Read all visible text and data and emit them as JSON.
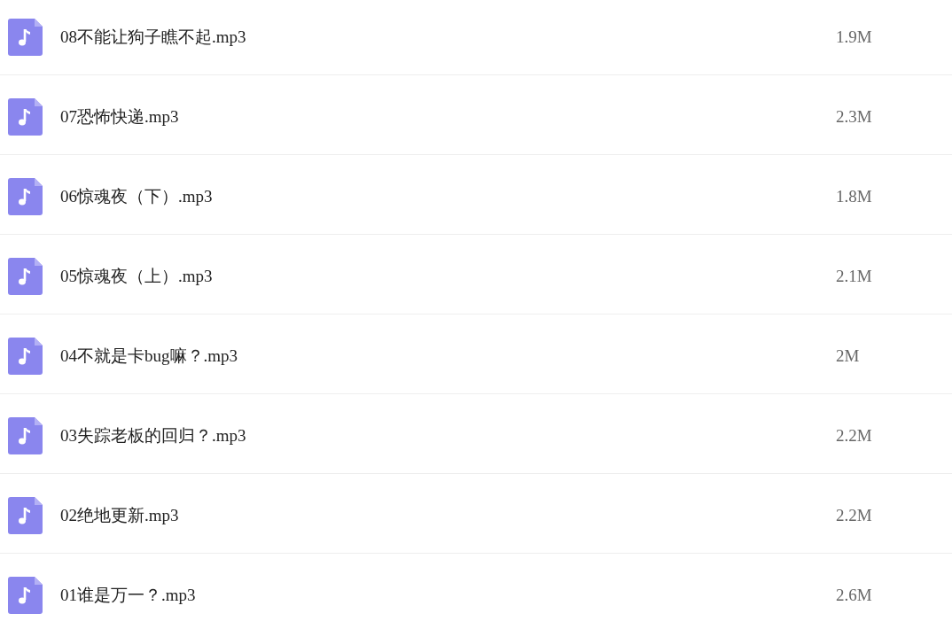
{
  "files": [
    {
      "name": "08不能让狗子瞧不起.mp3",
      "size": "1.9M"
    },
    {
      "name": "07恐怖快递.mp3",
      "size": "2.3M"
    },
    {
      "name": "06惊魂夜（下）.mp3",
      "size": "1.8M"
    },
    {
      "name": "05惊魂夜（上）.mp3",
      "size": "2.1M"
    },
    {
      "name": "04不就是卡bug嘛？.mp3",
      "size": "2M"
    },
    {
      "name": "03失踪老板的回归？.mp3",
      "size": "2.2M"
    },
    {
      "name": "02绝地更新.mp3",
      "size": "2.2M"
    },
    {
      "name": "01谁是万一？.mp3",
      "size": "2.6M"
    }
  ]
}
